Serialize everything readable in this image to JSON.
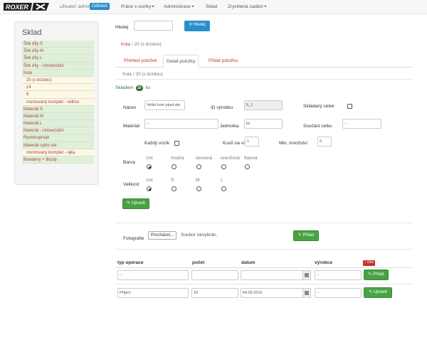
{
  "nav": {
    "logo_text": "ROXER",
    "user_label": "uživatel: admin",
    "logout_label": "Odhlásit",
    "menu": [
      "Práce s vozíky",
      "Administrace",
      "Sklad",
      "Zrychlená zadání"
    ]
  },
  "sidebar": {
    "title": "Sklad",
    "items": [
      {
        "label": "Šité díly S",
        "style": "green"
      },
      {
        "label": "Šité díly M",
        "style": "green"
      },
      {
        "label": "Šité díly L",
        "style": "green"
      },
      {
        "label": "Šité díly - Univerzální",
        "style": "green"
      },
      {
        "label": "Kola",
        "style": "green"
      },
      {
        "label": "20 (s brzdou)",
        "style": "yellow"
      },
      {
        "label": "14",
        "style": "yellow"
      },
      {
        "label": "6",
        "style": "yellow"
      },
      {
        "label": "montovaný komplet - vidlice",
        "style": "yellow"
      },
      {
        "label": "Materiál S",
        "style": "green"
      },
      {
        "label": "Materiál M",
        "style": "green"
      },
      {
        "label": "Materiál L",
        "style": "green"
      },
      {
        "label": "Materiál - Univerzální",
        "style": "green"
      },
      {
        "label": "Rychloupínák",
        "style": "green"
      },
      {
        "label": "Materiál cyklo set",
        "style": "green"
      },
      {
        "label": "montovaný komplet - ojka",
        "style": "yellow"
      },
      {
        "label": "Bowdeny + Brzdy",
        "style": "green"
      }
    ]
  },
  "search": {
    "label": "Hledej",
    "value": "",
    "button_label": "Hledej"
  },
  "breadcrumb": {
    "parent": "Kola",
    "separator": "/",
    "current": "20 (s brzdou)"
  },
  "tabs": [
    {
      "label": "Přehled položek",
      "active": false
    },
    {
      "label": "Detail položky",
      "active": true
    },
    {
      "label": "Přidat položku",
      "active": false
    }
  ],
  "breadcrumb2": {
    "parent": "Kola",
    "separator": "/",
    "current": "20 (s brzdou)"
  },
  "stock": {
    "label": "Skladem",
    "count": "10",
    "unit": "ks"
  },
  "detail": {
    "name_label": "Název",
    "name_value": "Velké kolo plast der",
    "id_label": "ID výrobku",
    "id_value": "6_1",
    "composite_label": "Skládaný celek",
    "material_label": "Materiál",
    "material_value": "--",
    "unit_label": "Jednotka",
    "unit_value": "ks",
    "part_of_label": "Součást celku",
    "part_of_value": "--",
    "each_cart_label": "Každý vozík",
    "pieces_label": "Kusů na vozík",
    "pieces_value": "1",
    "min_label": "Min. množství",
    "min_value": "5",
    "color_label": "Barva",
    "color_options": [
      "Uni",
      "modrá",
      "červená",
      "oranžová",
      "fialová"
    ],
    "color_selected": "Uni",
    "size_label": "Velikost",
    "size_options": [
      "Uni",
      "S",
      "M",
      "L"
    ],
    "size_selected": "Uni",
    "update_button": "Upravit"
  },
  "photo": {
    "label": "Fotografie",
    "browse_label": "Procházet...",
    "no_file": "Soubor nevybrán.",
    "add_button": "Přidat"
  },
  "ops_table": {
    "headers": [
      "typ operace",
      "počet",
      "datum",
      "výrobce"
    ],
    "more_badge": "více",
    "new_row": {
      "type": "--",
      "count": "",
      "date": "",
      "maker": "--",
      "button": "Přidat"
    },
    "rows": [
      {
        "type": "Příjem",
        "count": "10",
        "date": "04.09.2016",
        "maker": "--",
        "button": "Upravit"
      }
    ]
  },
  "colors": {
    "primary": "#2a8ec9",
    "success": "#48a343",
    "link_red": "#c0392b",
    "sidebar_green": "#dff0d8",
    "sidebar_yellow": "#fcf8e3"
  }
}
